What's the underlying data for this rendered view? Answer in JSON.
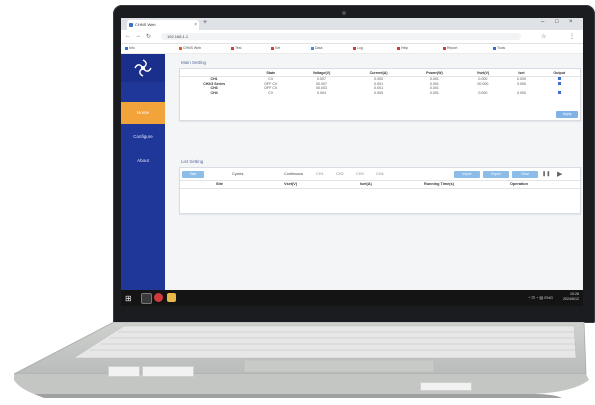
{
  "browser": {
    "tab_title": "CHNS Web",
    "tab_close": "×",
    "new_tab": "+",
    "window_controls": [
      "–",
      "□",
      "×"
    ],
    "address": "192.168.1.1",
    "nav": [
      "←",
      "→",
      "↻"
    ],
    "toolbar_icons": [
      "☆",
      "⋮"
    ],
    "bookmarks": [
      "Info",
      "CHNS Web",
      "Test",
      "Set",
      "Data",
      "Log",
      "Help",
      "Report",
      "Tools"
    ]
  },
  "sidebar": {
    "items": [
      {
        "label": "Home",
        "active": true
      },
      {
        "label": "Configure",
        "active": false
      },
      {
        "label": "About",
        "active": false
      }
    ]
  },
  "main_setting": {
    "title": "Main Setting",
    "columns": [
      "",
      "State",
      "Voltage(V)",
      "Current(A)",
      "Power(W)",
      "Vset(V)",
      "Iset",
      "Output"
    ],
    "rows": [
      {
        "name": "CH1",
        "state": "CV",
        "voltage": "0.007",
        "current": "0.000",
        "power": "0.001",
        "vset": "0.000",
        "iset": "0.000",
        "output": true
      },
      {
        "name": "CH2/3 Series",
        "state": "OFF CV",
        "voltage": "00.007",
        "current": "0.001",
        "power": "0.001",
        "vset": "00.000",
        "iset": "0.000",
        "output": true
      },
      {
        "name": "CH3",
        "state": "OFF CV",
        "voltage": "00.003",
        "current": "0.001",
        "power": "0.001",
        "vset": "",
        "iset": "",
        "output": false
      },
      {
        "name": "CH4",
        "state": "CV",
        "voltage": "0.004",
        "current": "0.000",
        "power": "0.001",
        "vset": "0.000",
        "iset": "0.000",
        "output": true
      }
    ],
    "apply_label": "Apply"
  },
  "list_setting": {
    "title": "List Setting",
    "start_label": "Start",
    "cycles_label": "Cycles",
    "continuous_label": "Continuous",
    "channel_labels": [
      "CH1",
      "CH2",
      "CH3",
      "CH4"
    ],
    "action_buttons": [
      "Import",
      "Export",
      "Clear"
    ],
    "play_controls": [
      "❚❚",
      "▶"
    ],
    "columns": [
      "Site",
      "Vset(V)",
      "Iset(A)",
      "Running Time(s)",
      "Operation"
    ]
  },
  "taskbar": {
    "start_glyph": "⊞",
    "time": "10:26",
    "date": "2024/6/12",
    "tray_icons": "^ ⊡ ◔ ▤ ENG"
  },
  "colors": {
    "sidebar": "#20379a",
    "active_nav": "#f2a33a",
    "accent_button": "#8cbce8",
    "taskbar": "#141414"
  }
}
